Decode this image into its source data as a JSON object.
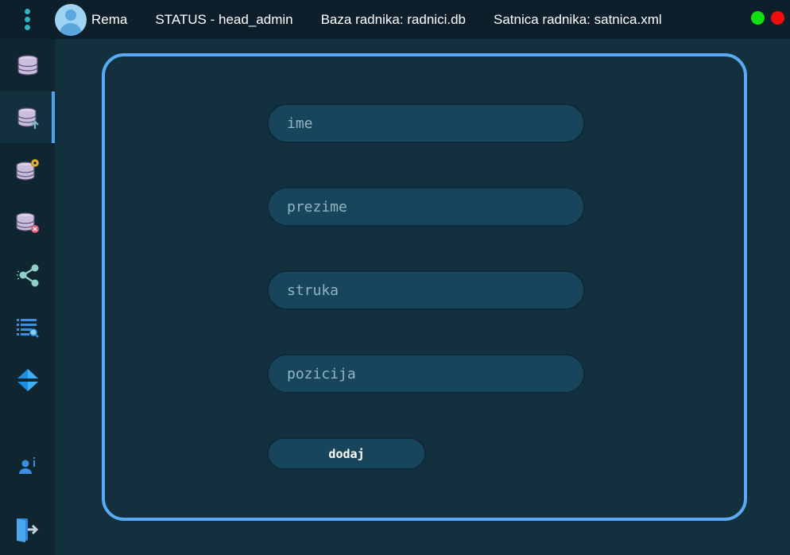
{
  "topbar": {
    "user_name": "Rema",
    "status": "STATUS - head_admin",
    "db": "Baza radnika: radnici.db",
    "schedule": "Satnica radnika: satnica.xml",
    "icons": [
      "menu-icon",
      "avatar"
    ]
  },
  "colors": {
    "accent": "#4ea3f0",
    "panel_border": "#5aaaf5",
    "green_dot": "#10e010",
    "red_dot": "#f20d0d"
  },
  "sidebar": {
    "items": [
      {
        "icon": "database-icon"
      },
      {
        "icon": "database-upload-icon",
        "active": true
      },
      {
        "icon": "database-settings-icon"
      },
      {
        "icon": "database-delete-icon"
      },
      {
        "icon": "share-icon"
      },
      {
        "icon": "list-search-icon"
      },
      {
        "icon": "sort-arrows-icon"
      },
      {
        "icon": "user-info-icon"
      },
      {
        "icon": "logout-icon"
      }
    ]
  },
  "form": {
    "ime_placeholder": "ime",
    "prezime_placeholder": "prezime",
    "struka_placeholder": "struka",
    "pozicija_placeholder": "pozicija",
    "submit_label": "dodaj"
  }
}
